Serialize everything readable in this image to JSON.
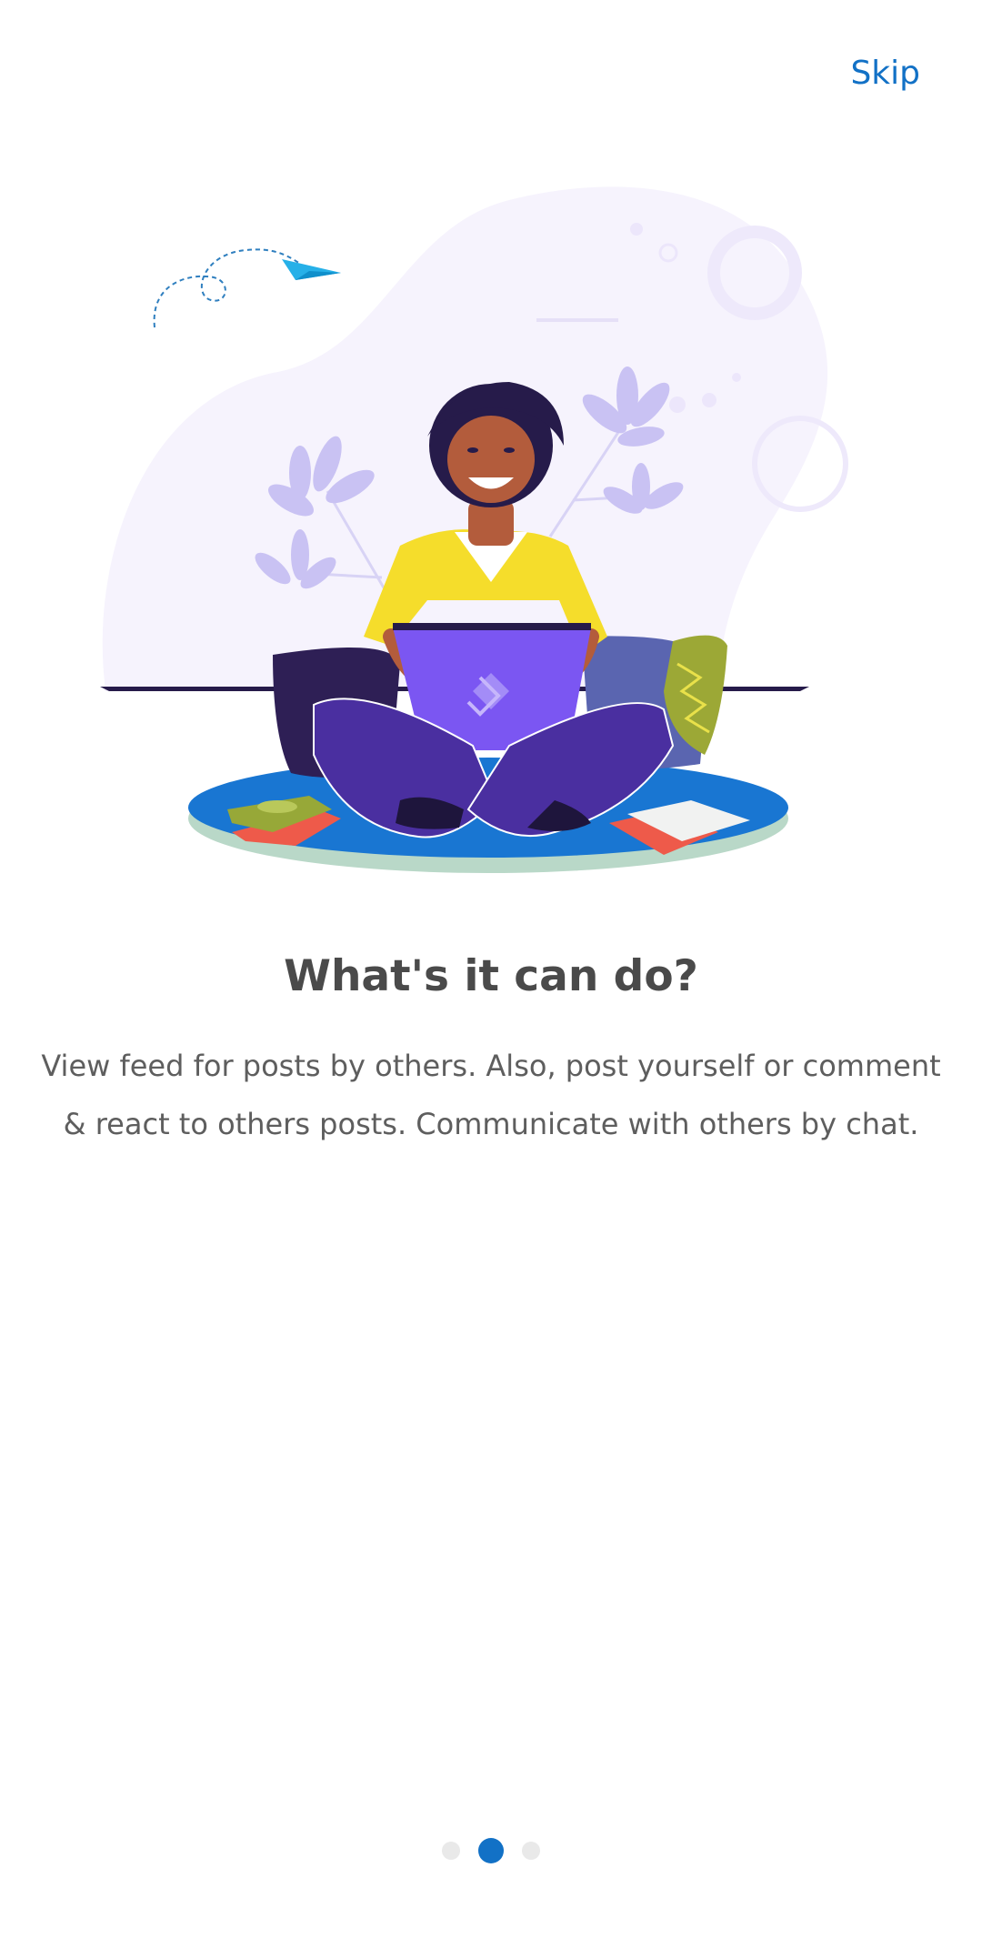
{
  "header": {
    "skip_label": "Skip"
  },
  "onboarding": {
    "title": "What's it can do?",
    "description": "View feed for posts by others. Also, post yourself or comment & react to others posts. Communicate with others by chat.",
    "page_indicator": {
      "total": 3,
      "active_index": 1
    }
  },
  "colors": {
    "accent": "#1271c6",
    "title": "#4a4a4a",
    "body_text": "#5e5e5e",
    "dot_inactive": "#e9e9e9"
  },
  "illustration": {
    "icon": "woman-with-laptop-illustration"
  }
}
